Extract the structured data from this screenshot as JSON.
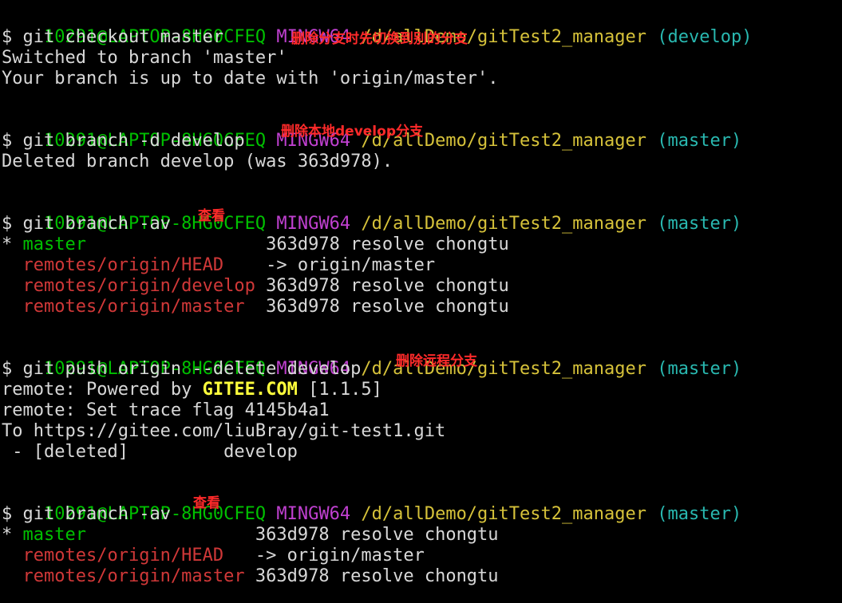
{
  "prompt": {
    "user_host": "10291@LAPTOP-8HG0CFEQ",
    "env": "MINGW64",
    "path": "/d/allDemo/gitTest2_manager",
    "branch_develop": "(develop)",
    "branch_master": "(master)",
    "dollar": "$ "
  },
  "block1": {
    "cmd": "git checkout master",
    "out1": "Switched to branch 'master'",
    "out2": "Your branch is up to date with 'origin/master'.",
    "note": "删除分支时先切换到别的分支"
  },
  "block2": {
    "cmd": "git branch -d develop",
    "out1": "Deleted branch develop (was 363d978).",
    "note": "删除本地develop分支"
  },
  "block3": {
    "cmd": "git branch -av",
    "note": "查看",
    "rows": [
      {
        "mark": "* ",
        "name": "master                 ",
        "info": "363d978 resolve chongtu"
      },
      {
        "mark": "  ",
        "name": "remotes/origin/HEAD    ",
        "info": "-> origin/master"
      },
      {
        "mark": "  ",
        "name": "remotes/origin/develop ",
        "info": "363d978 resolve chongtu"
      },
      {
        "mark": "  ",
        "name": "remotes/origin/master  ",
        "info": "363d978 resolve chongtu"
      }
    ]
  },
  "block4": {
    "cmd": "git push origin --delete develop",
    "note": "删除远程分支",
    "out1_prefix": "remote: Powered by ",
    "out1_brand": "GITEE.COM",
    "out1_suffix": " [1.1.5]",
    "out2": "remote: Set trace flag 4145b4a1",
    "out3": "To https://gitee.com/liuBray/git-test1.git",
    "out4": " - [deleted]         develop"
  },
  "block5": {
    "cmd": "git branch -av",
    "note": "查看",
    "rows": [
      {
        "mark": "* ",
        "name": "master                ",
        "info": "363d978 resolve chongtu"
      },
      {
        "mark": "  ",
        "name": "remotes/origin/HEAD   ",
        "info": "-> origin/master"
      },
      {
        "mark": "  ",
        "name": "remotes/origin/master ",
        "info": "363d978 resolve chongtu"
      }
    ]
  },
  "colors": {
    "background": "#000000",
    "user_host": "#00c000",
    "env": "#c040d0",
    "path": "#d6c23a",
    "branch": "#29b8b0",
    "remote_branch": "#d03838",
    "annotation": "#ff2a2a"
  }
}
